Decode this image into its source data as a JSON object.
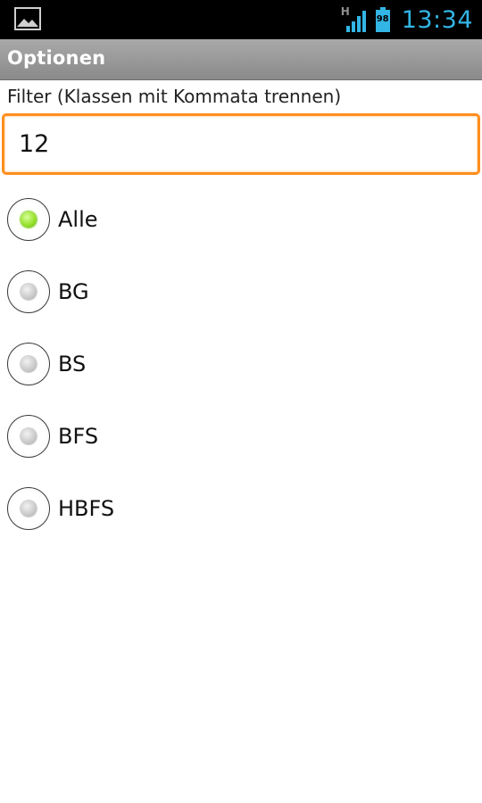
{
  "status_bar": {
    "network_type": "H",
    "battery_level": "98",
    "clock": "13:34",
    "icons": [
      "gallery-notification-icon",
      "signal-icon",
      "battery-icon"
    ],
    "colors": {
      "background": "#000000",
      "clock": "#33b5e5",
      "battery": "#33b5e5"
    }
  },
  "title_bar": {
    "title": "Optionen"
  },
  "filter": {
    "label": "Filter (Klassen mit Kommata trennen)",
    "value": "12",
    "focus_color": "#ff8f1f"
  },
  "radio_group": {
    "options": [
      {
        "label": "Alle",
        "checked": true
      },
      {
        "label": "BG",
        "checked": false
      },
      {
        "label": "BS",
        "checked": false
      },
      {
        "label": "BFS",
        "checked": false
      },
      {
        "label": "HBFS",
        "checked": false
      }
    ],
    "checked_color": "#98e22e"
  }
}
